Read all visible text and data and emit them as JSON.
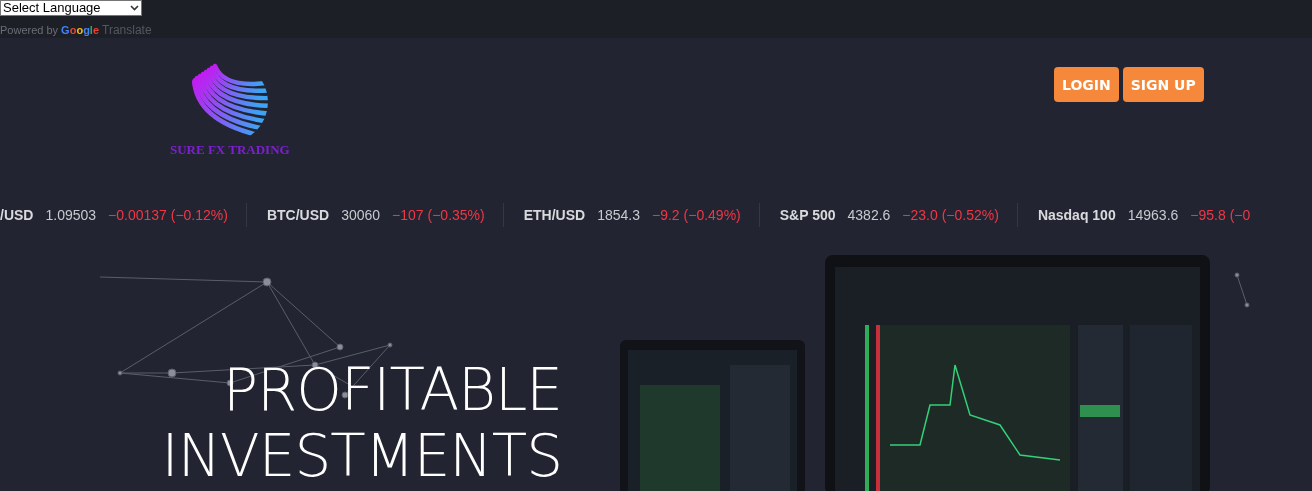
{
  "translate_bar": {
    "language_select": {
      "value": "Select Language"
    },
    "powered_by": "Powered by",
    "google": "Google",
    "translate": "Translate"
  },
  "header": {
    "logo_text": "SURE FX TRADING",
    "buttons": [
      "LOGIN",
      "SIGN UP"
    ]
  },
  "ticker": [
    {
      "symbol": "/USD",
      "price": "1.09503",
      "change": "−0.00137 (−0.12%)"
    },
    {
      "symbol": "BTC/USD",
      "price": "30060",
      "change": "−107 (−0.35%)"
    },
    {
      "symbol": "ETH/USD",
      "price": "1854.3",
      "change": "−9.2 (−0.49%)"
    },
    {
      "symbol": "S&P 500",
      "price": "4382.6",
      "change": "−23.0 (−0.52%)"
    },
    {
      "symbol": "Nasdaq 100",
      "price": "14963.6",
      "change": "−95.8 (−0"
    }
  ],
  "hero": {
    "heading": [
      "PROFITABLE",
      "INVESTMENTS"
    ]
  }
}
